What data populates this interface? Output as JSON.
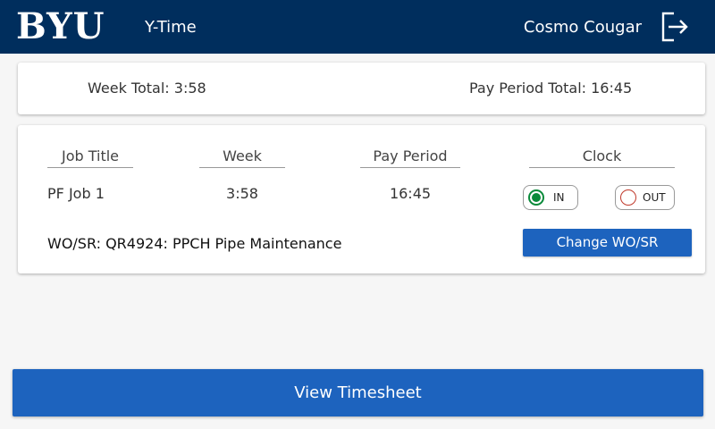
{
  "header": {
    "logo_text": "BYU",
    "app_title": "Y-Time",
    "user_name": "Cosmo Cougar",
    "logout_icon": "logout-icon"
  },
  "totals": {
    "week_total": "Week Total: 3:58",
    "pay_period_total": "Pay Period Total: 16:45"
  },
  "job": {
    "columns": {
      "job_title": "Job Title",
      "week": "Week",
      "pay_period": "Pay Period",
      "clock": "Clock"
    },
    "title": "PF Job 1",
    "week": "3:58",
    "pay_period": "16:45",
    "clock": {
      "in_label": "IN",
      "out_label": "OUT",
      "selected": "IN",
      "in_color": "#0a8a3a",
      "out_color": "#c0392b"
    },
    "wo_sr": "WO/SR: QR4924: PPCH Pipe Maintenance",
    "change_button": "Change WO/SR"
  },
  "footer": {
    "view_timesheet": "View Timesheet"
  },
  "colors": {
    "header_bg": "#002e5d",
    "button_bg": "#1d63be"
  }
}
